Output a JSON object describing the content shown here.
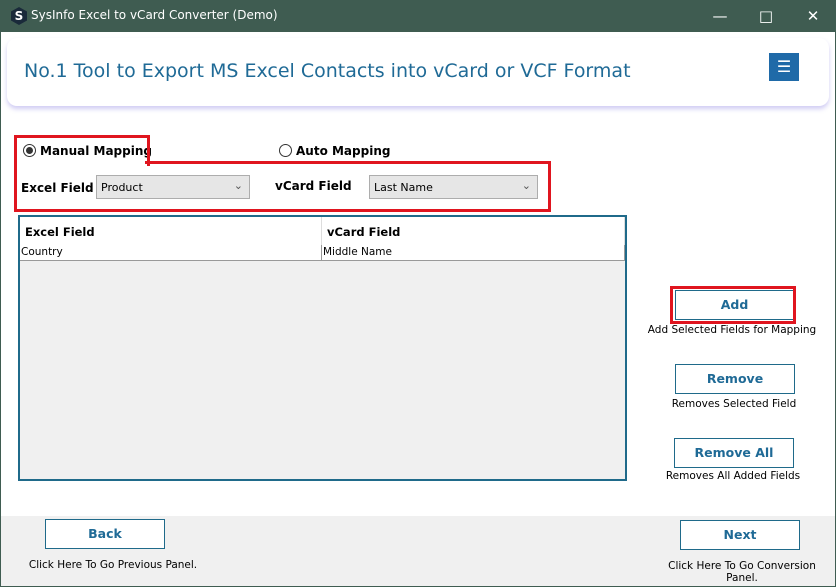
{
  "window": {
    "title": "SysInfo Excel to vCard Converter (Demo)",
    "logo": "S"
  },
  "banner": {
    "heading": "No.1 Tool to Export MS Excel Contacts into vCard or VCF Format",
    "menu_icon": "☰"
  },
  "mapping": {
    "manual_label": "Manual Mapping",
    "auto_label": "Auto Mapping",
    "selected": "manual",
    "excel_field_label": "Excel Field",
    "excel_field_value": "Product",
    "vcard_field_label": "vCard Field",
    "vcard_field_value": "Last Name"
  },
  "grid": {
    "columns": [
      "Excel Field",
      "vCard Field"
    ],
    "rows": [
      [
        "Country",
        "Middle Name"
      ]
    ]
  },
  "actions": {
    "add": "Add",
    "add_caption": "Add Selected Fields for Mapping",
    "remove": "Remove",
    "remove_caption": "Removes Selected Field",
    "remove_all": "Remove All",
    "remove_all_caption": "Removes All Added Fields"
  },
  "footer": {
    "back": "Back",
    "back_caption": "Click Here To Go Previous Panel.",
    "next": "Next",
    "next_caption": "Click Here To Go Conversion Panel."
  },
  "colors": {
    "highlight": "#e0151f",
    "accent": "#1f6a96",
    "titlebar": "#3f5c51"
  }
}
